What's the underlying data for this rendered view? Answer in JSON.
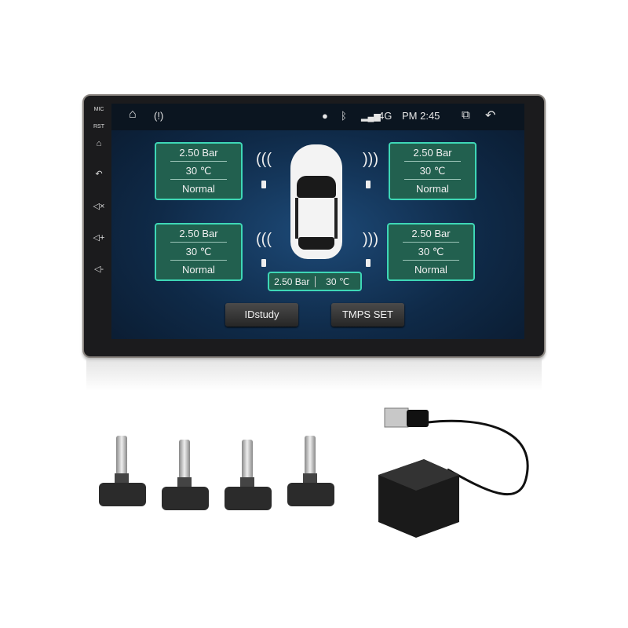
{
  "side_buttons": {
    "mic": "MIC",
    "rst": "RST",
    "icons": [
      "home-icon",
      "back-icon",
      "mute-icon",
      "volume-up-icon",
      "volume-down-icon"
    ]
  },
  "statusbar": {
    "network": "4G",
    "time": "PM 2:45",
    "icons": [
      "home-icon",
      "tpms-warning-icon",
      "location-icon",
      "bluetooth-icon",
      "signal-icon",
      "recent-apps-icon",
      "back-icon"
    ]
  },
  "tires": {
    "front_left": {
      "pressure": "2.50  Bar",
      "temp": "30  ℃",
      "status": "Normal"
    },
    "front_right": {
      "pressure": "2.50  Bar",
      "temp": "30  ℃",
      "status": "Normal"
    },
    "rear_left": {
      "pressure": "2.50  Bar",
      "temp": "30  ℃",
      "status": "Normal"
    },
    "rear_right": {
      "pressure": "2.50  Bar",
      "temp": "30  ℃",
      "status": "Normal"
    }
  },
  "spare": {
    "pressure": "2.50 Bar",
    "temp": "30  ℃"
  },
  "buttons": {
    "idstudy": "IDstudy",
    "tpms_set": "TMPS SET"
  },
  "colors": {
    "card_border": "#3ed7b6",
    "card_fill": "#22604f",
    "screen_bg": "#0f2a48"
  }
}
